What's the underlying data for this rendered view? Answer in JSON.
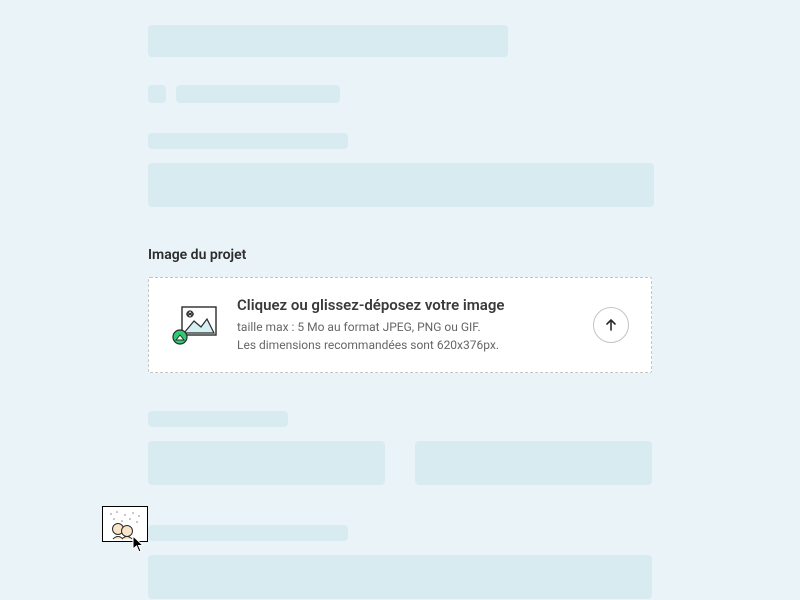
{
  "section": {
    "label": "Image du projet"
  },
  "upload": {
    "title": "Cliquez ou glissez-déposez votre image",
    "max_line": "taille max : 5 Mo au format JPEG, PNG ou GIF.",
    "dim_line": "Les dimensions recommandées sont 620x376px."
  }
}
